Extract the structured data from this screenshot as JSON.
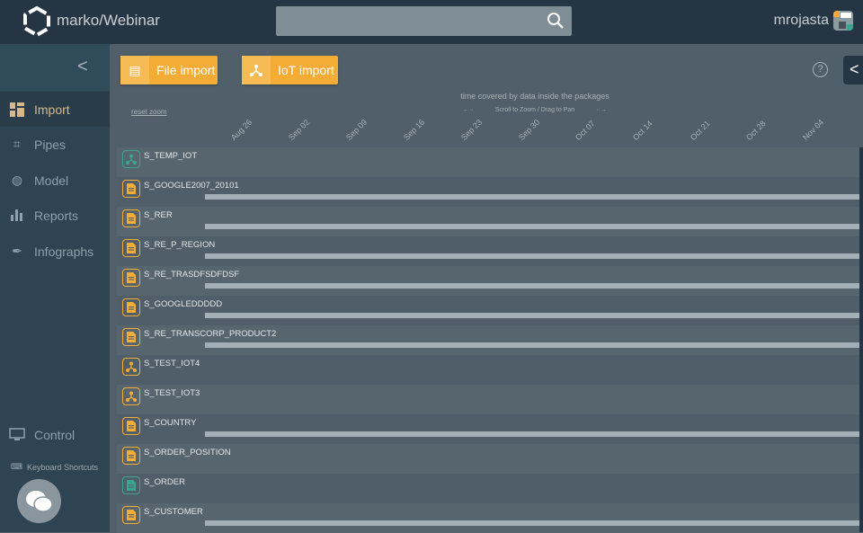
{
  "header": {
    "title": "marko/Webinar",
    "search_placeholder": "",
    "user": "mrojasta"
  },
  "sidebar": {
    "items": [
      {
        "label": "Import",
        "icon": "grid-icon",
        "active": true
      },
      {
        "label": "Pipes",
        "icon": "crop-icon"
      },
      {
        "label": "Model",
        "icon": "globe-icon"
      },
      {
        "label": "Reports",
        "icon": "bar-chart-icon"
      },
      {
        "label": "Infographs",
        "icon": "feather-icon"
      },
      {
        "label": "Control",
        "icon": "monitor-icon"
      }
    ],
    "keyboard_shortcuts": "Keyboard Shortcuts"
  },
  "toolbar": {
    "file_import": "File import",
    "iot_import": "IoT import"
  },
  "timeline": {
    "caption": "time covered by data inside the packages",
    "hint": "Scroll to Zoom / Drag to Pan",
    "hint_left": "←··",
    "hint_right": "··→",
    "reset_zoom": "reset zoom",
    "ticks": [
      "Aug 26",
      "Sep 02",
      "Sep 09",
      "Sep 16",
      "Sep 23",
      "Sep 30",
      "Oct 07",
      "Oct 14",
      "Oct 21",
      "Oct 28",
      "Nov 04"
    ],
    "rows": [
      {
        "name": "S_TEMP_IOT",
        "type": "iot",
        "color": "#3aa58f",
        "bar": false
      },
      {
        "name": "S_GOOGLE2007_20101",
        "type": "file",
        "color": "#f4ac35",
        "bar": true
      },
      {
        "name": "S_RER",
        "type": "file",
        "color": "#f4ac35",
        "bar": true
      },
      {
        "name": "S_RE_P_REGION",
        "type": "file",
        "color": "#f4ac35",
        "bar": true
      },
      {
        "name": "S_RE_TRASDFSDFDSF",
        "type": "file",
        "color": "#f4ac35",
        "bar": true
      },
      {
        "name": "S_GOOGLEDDDDD",
        "type": "file",
        "color": "#f4ac35",
        "bar": true
      },
      {
        "name": "S_RE_TRANSCORP_PRODUCT2",
        "type": "file",
        "color": "#f4ac35",
        "bar": true
      },
      {
        "name": "S_TEST_IOT4",
        "type": "iot",
        "color": "#f4ac35",
        "bar": false
      },
      {
        "name": "S_TEST_IOT3",
        "type": "iot",
        "color": "#f4ac35",
        "bar": false
      },
      {
        "name": "S_COUNTRY",
        "type": "file",
        "color": "#f4ac35",
        "bar": true
      },
      {
        "name": "S_ORDER_POSITION",
        "type": "file",
        "color": "#f4ac35",
        "bar": false
      },
      {
        "name": "S_ORDER",
        "type": "file",
        "color": "#3aa58f",
        "bar": false
      },
      {
        "name": "S_CUSTOMER",
        "type": "file",
        "color": "#f4ac35",
        "bar": true
      }
    ]
  }
}
